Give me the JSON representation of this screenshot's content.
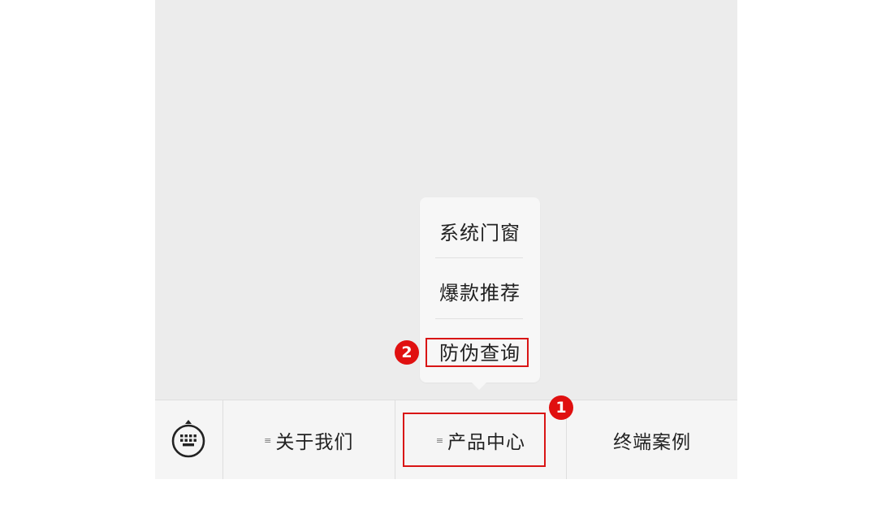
{
  "submenu": {
    "items": [
      {
        "label": "系统门窗"
      },
      {
        "label": "爆款推荐"
      },
      {
        "label": "防伪查询"
      }
    ]
  },
  "navbar": {
    "keyboard_icon": "keyboard-icon",
    "items": [
      {
        "label": "关于我们",
        "has_submenu": true
      },
      {
        "label": "产品中心",
        "has_submenu": true
      },
      {
        "label": "终端案例",
        "has_submenu": false
      }
    ],
    "submenu_glyph": "≡"
  },
  "annotations": {
    "marker_1": "1",
    "marker_2": "2",
    "color": "#d91515"
  }
}
